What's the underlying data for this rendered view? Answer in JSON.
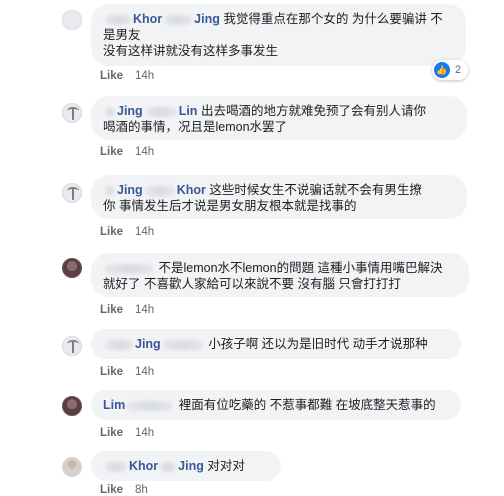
{
  "comments": [
    {
      "name_parts": [
        "Khor",
        "Jing"
      ],
      "text_line1": "我觉得重点在那个女的 为什么要骗讲 不",
      "text_line2": "是男友",
      "text_line3": "没有这样讲就没有这样多事发生",
      "like": "Like",
      "time": "14h",
      "reaction_count": "2"
    },
    {
      "name_parts": [
        "Jing",
        "Lin"
      ],
      "text_line1": "出去喝酒的地方就难免预了会有别人请你",
      "text_line2": "喝酒的事情，况且是lemon水罢了",
      "like": "Like",
      "time": "14h"
    },
    {
      "name_parts": [
        "Jing",
        "Khor"
      ],
      "text_line1": "这些时候女生不说骗话就不会有男生撩",
      "text_line2": "你 事情发生后才说是男女朋友根本就是找事的",
      "like": "Like",
      "time": "14h"
    },
    {
      "text_line1": "不是lemon水不lemon的問題 這種小事情用嘴巴解決",
      "text_line2": "就好了 不喜歡人家給可以來說不要 沒有腦 只會打打打",
      "like": "Like",
      "time": "14h"
    },
    {
      "name_parts": [
        "Jing"
      ],
      "text_line1": "小孩子啊 还以为是旧时代 动手才说那种",
      "like": "Like",
      "time": "14h"
    },
    {
      "name_parts": [
        "Lim"
      ],
      "text_line1": "裡面有位吃藥的 不惹事都難 在坡底整天惹事的",
      "like": "Like",
      "time": "14h"
    },
    {
      "name_parts": [
        "Khor",
        "Jing"
      ],
      "text_line1": "对对对",
      "like": "Like",
      "time": "8h"
    }
  ]
}
